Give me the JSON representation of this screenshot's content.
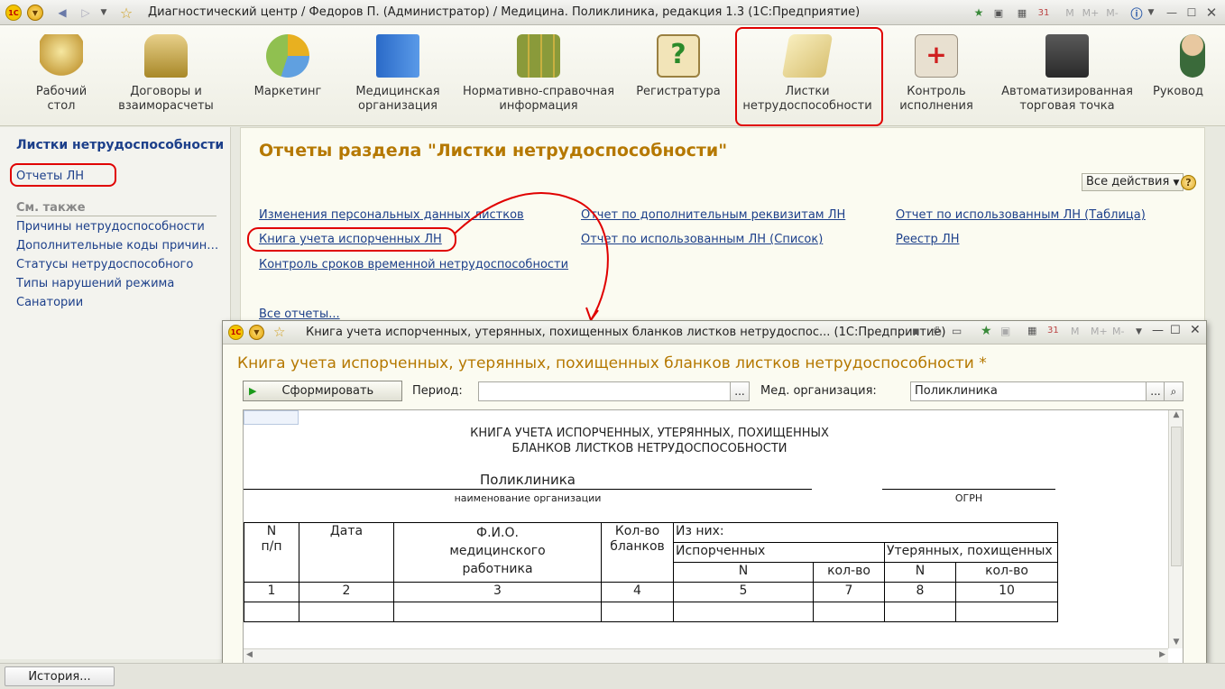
{
  "window": {
    "title": "Диагностический центр / Федоров П. (Администратор) / Медицина. Поликлиника, редакция 1.3  (1С:Предприятие)",
    "logo_text": "1С",
    "toolbar_m_labels": [
      "M",
      "M+",
      "M-"
    ]
  },
  "sections": [
    {
      "label": "Рабочий\nстол",
      "icon": "desktop-icon"
    },
    {
      "label": "Договоры и\nвзаиморасчеты",
      "icon": "coins-icon"
    },
    {
      "label": "Маркетинг",
      "icon": "pie-chart-icon"
    },
    {
      "label": "Медицинская\nорганизация",
      "icon": "building-icon"
    },
    {
      "label": "Нормативно-справочная\nинформация",
      "icon": "binders-icon"
    },
    {
      "label": "Регистратура",
      "icon": "clipboard-question-icon"
    },
    {
      "label": "Листки\nнетрудоспособности",
      "icon": "sheets-icon"
    },
    {
      "label": "Контроль\nисполнения",
      "icon": "medkit-icon"
    },
    {
      "label": "Автоматизированная\nторговая точка",
      "icon": "cash-register-icon"
    },
    {
      "label": "Руковод",
      "icon": "person-icon"
    }
  ],
  "left_panel": {
    "heading": "Листки нетрудоспособности",
    "current_item": "Отчеты ЛН",
    "see_also_label": "См. также",
    "items": [
      "Причины нетрудоспособности",
      "Дополнительные коды причин н...",
      "Статусы нетрудоспособного",
      "Типы нарушений режима",
      "Санатории"
    ]
  },
  "main": {
    "title": "Отчеты раздела \"Листки нетрудоспособности\"",
    "all_actions": "Все действия",
    "links_col1": [
      "Изменения персональных данных листков",
      "Книга учета испорченных ЛН",
      "Контроль сроков временной нетрудоспособности"
    ],
    "links_col2": [
      "Отчет по дополнительным реквизитам ЛН",
      "Отчет по использованным ЛН (Список)"
    ],
    "links_col3": [
      "Отчет по использованным ЛН (Таблица)",
      "Реестр ЛН"
    ],
    "all_reports": "Все отчеты..."
  },
  "report_window": {
    "title": "Книга учета испорченных, утерянных, похищенных бланков листков нетрудоспос...  (1С:Предприятие)",
    "heading": "Книга учета испорченных, утерянных, похищенных бланков листков нетрудоспособности *",
    "generate_button": "Сформировать",
    "period_label": "Период:",
    "period_value": "",
    "med_org_label": "Мед. организация:",
    "med_org_value": "Поликлиника",
    "report": {
      "title_line1": "КНИГА УЧЕТА ИСПОРЧЕННЫХ, УТЕРЯННЫХ, ПОХИЩЕННЫХ",
      "title_line2": "БЛАНКОВ ЛИСТКОВ НЕТРУДОСПОСОБНОСТИ",
      "org_name": "Поликлиника",
      "org_caption": "наименование организации",
      "ogrn_caption": "ОГРН",
      "col_num": "N\nп/п",
      "col_date": "Дата",
      "col_fio": "Ф.И.О.\nмедицинского\nработника",
      "col_count": "Кол-во\nбланков",
      "col_of_them": "Из них:",
      "col_spoiled": "Испорченных",
      "col_lost": "Утерянных, похищенных",
      "sub_n": "N",
      "sub_qty": "кол-во",
      "numbers": [
        "1",
        "2",
        "3",
        "4",
        "5",
        "7",
        "8",
        "10"
      ]
    }
  },
  "bottom": {
    "history_button": "История..."
  }
}
